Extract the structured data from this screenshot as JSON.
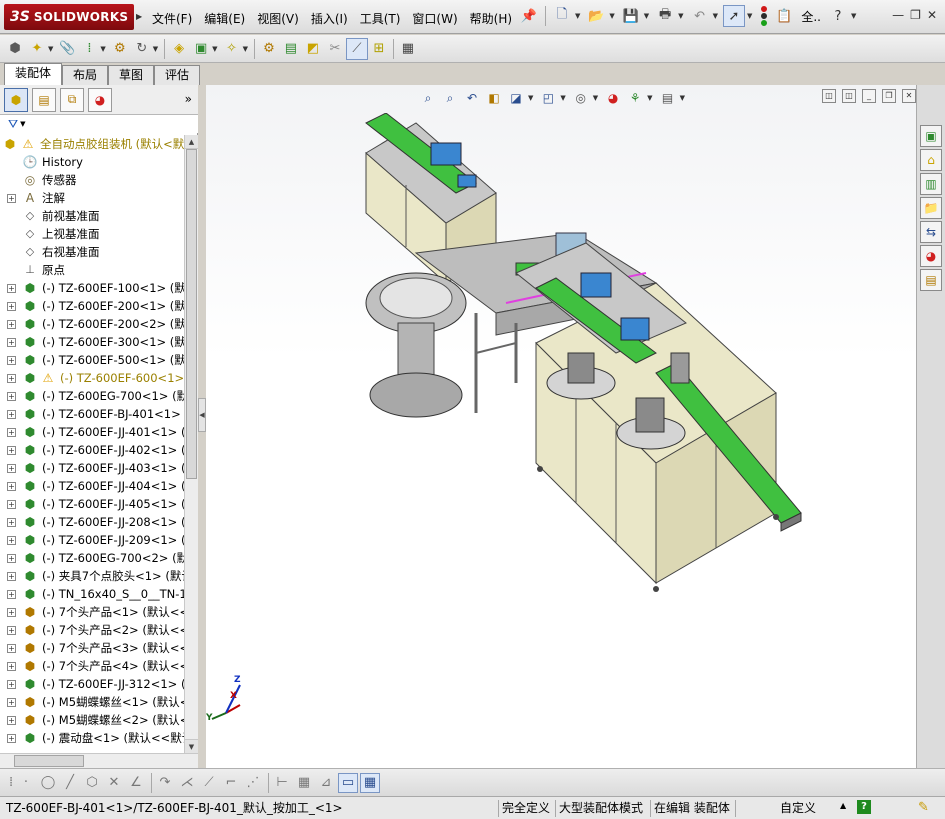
{
  "app": {
    "logo_mark": "3S",
    "logo_name": "SOLIDWORKS"
  },
  "menu": [
    "文件(F)",
    "编辑(E)",
    "视图(V)",
    "插入(I)",
    "工具(T)",
    "窗口(W)",
    "帮助(H)"
  ],
  "title_toolbar": {
    "search_label": "全..",
    "help_label": "?",
    "icons": [
      "pushpin-icon",
      "new-document-icon",
      "open-icon",
      "save-icon",
      "print-icon",
      "undo-icon",
      "select-icon",
      "rebuild-icon",
      "options-icon"
    ]
  },
  "window_controls": [
    "minimize-icon",
    "restore-icon",
    "close-icon"
  ],
  "command_tabs": [
    "装配体",
    "布局",
    "草图",
    "评估"
  ],
  "active_command_tab": "装配体",
  "feature_tree": {
    "root": "全自动点胶组装机  (默认<默",
    "items": [
      {
        "label": "History",
        "icon": "history-icon",
        "expandable": false
      },
      {
        "label": "传感器",
        "icon": "sensor-icon",
        "expandable": false
      },
      {
        "label": "注解",
        "icon": "annotation-icon",
        "expandable": true
      },
      {
        "label": "前视基准面",
        "icon": "plane-icon",
        "expandable": false
      },
      {
        "label": "上视基准面",
        "icon": "plane-icon",
        "expandable": false
      },
      {
        "label": "右视基准面",
        "icon": "plane-icon",
        "expandable": false
      },
      {
        "label": "原点",
        "icon": "origin-icon",
        "expandable": false
      },
      {
        "label": "(-) TZ-600EF-100<1> (默认<",
        "icon": "subassembly-icon",
        "expandable": true
      },
      {
        "label": "(-) TZ-600EF-200<1> (默认<",
        "icon": "subassembly-icon",
        "expandable": true
      },
      {
        "label": "(-) TZ-600EF-200<2> (默认<",
        "icon": "subassembly-icon",
        "expandable": true
      },
      {
        "label": "(-) TZ-600EF-300<1> (默认<",
        "icon": "subassembly-icon",
        "expandable": true
      },
      {
        "label": "(-) TZ-600EF-500<1> (默认<",
        "icon": "subassembly-icon",
        "expandable": true
      },
      {
        "label": "(-) TZ-600EF-600<1> (默",
        "icon": "subassembly-icon",
        "expandable": true,
        "warning": true
      },
      {
        "label": "(-) TZ-600EG-700<1> (默认",
        "icon": "subassembly-icon",
        "expandable": true
      },
      {
        "label": "(-) TZ-600EF-BJ-401<1> (默",
        "icon": "subassembly-icon",
        "expandable": true
      },
      {
        "label": "(-) TZ-600EF-JJ-401<1> (默",
        "icon": "subassembly-icon",
        "expandable": true
      },
      {
        "label": "(-) TZ-600EF-JJ-402<1> (默",
        "icon": "subassembly-icon",
        "expandable": true
      },
      {
        "label": "(-) TZ-600EF-JJ-403<1> (默",
        "icon": "subassembly-icon",
        "expandable": true
      },
      {
        "label": "(-) TZ-600EF-JJ-404<1> (默",
        "icon": "subassembly-icon",
        "expandable": true
      },
      {
        "label": "(-) TZ-600EF-JJ-405<1> (默",
        "icon": "subassembly-icon",
        "expandable": true
      },
      {
        "label": "(-) TZ-600EF-JJ-208<1> (默",
        "icon": "subassembly-icon",
        "expandable": true
      },
      {
        "label": "(-) TZ-600EF-JJ-209<1> (默",
        "icon": "subassembly-icon",
        "expandable": true
      },
      {
        "label": "(-) TZ-600EG-700<2> (默认",
        "icon": "subassembly-icon",
        "expandable": true
      },
      {
        "label": "(-) 夹具7个点胶头<1> (默认",
        "icon": "subassembly-icon",
        "expandable": true
      },
      {
        "label": "(-) TN_16x40_S__0__TN-16x",
        "icon": "subassembly-icon",
        "expandable": true
      },
      {
        "label": "(-) 7个头产品<1> (默认<<",
        "icon": "part-icon",
        "expandable": true
      },
      {
        "label": "(-) 7个头产品<2> (默认<<",
        "icon": "part-icon",
        "expandable": true
      },
      {
        "label": "(-) 7个头产品<3> (默认<<",
        "icon": "part-icon",
        "expandable": true
      },
      {
        "label": "(-) 7个头产品<4> (默认<<",
        "icon": "part-icon",
        "expandable": true
      },
      {
        "label": "(-) TZ-600EF-JJ-312<1> (默",
        "icon": "subassembly-icon",
        "expandable": true
      },
      {
        "label": "(-) M5蝴蝶螺丝<1> (默认<",
        "icon": "part-icon",
        "expandable": true
      },
      {
        "label": "(-) M5蝴蝶螺丝<2> (默认<",
        "icon": "part-icon",
        "expandable": true
      },
      {
        "label": "(-) 震动盘<1> (默认<<默认",
        "icon": "subassembly-icon",
        "expandable": true
      }
    ]
  },
  "triad": {
    "x": "X",
    "y": "Y",
    "z": "Z"
  },
  "status_bar": {
    "path": "TZ-600EF-BJ-401<1>/TZ-600EF-BJ-401_默认_按加工_<1>",
    "definition": "完全定义",
    "mode": "大型装配体模式",
    "editing": "在编辑 装配体",
    "units": "自定义",
    "help": "?"
  },
  "colors": {
    "brand_red": "#b8141a",
    "warning": "#e0a100",
    "component_green": "#2f8a2f"
  }
}
